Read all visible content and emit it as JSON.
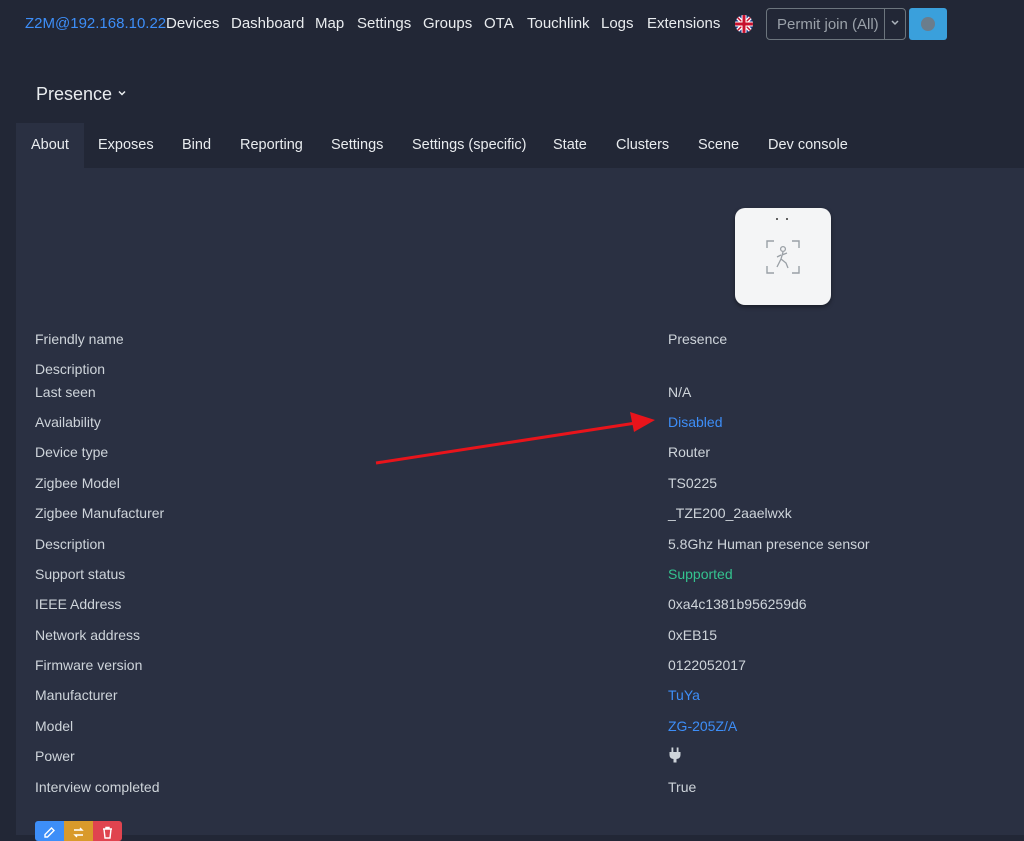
{
  "nav": {
    "brand": "Z2M@192.168.10.22",
    "items": [
      "Devices",
      "Dashboard",
      "Map",
      "Settings",
      "Groups",
      "OTA",
      "Touchlink",
      "Logs",
      "Extensions"
    ],
    "permit_join_label": "Permit join (All)"
  },
  "page": {
    "title": "Presence"
  },
  "tabs": [
    "About",
    "Exposes",
    "Bind",
    "Reporting",
    "Settings",
    "Settings (specific)",
    "State",
    "Clusters",
    "Scene",
    "Dev console"
  ],
  "about": {
    "rows": [
      {
        "label": "Friendly name",
        "value": "Presence"
      },
      {
        "label": "Description",
        "value": ""
      },
      {
        "label": "Last seen",
        "value": "N/A"
      },
      {
        "label": "Availability",
        "value": "Disabled"
      },
      {
        "label": "Device type",
        "value": "Router"
      },
      {
        "label": "Zigbee Model",
        "value": "TS0225"
      },
      {
        "label": "Zigbee Manufacturer",
        "value": "_TZE200_2aaelwxk"
      },
      {
        "label": "Description",
        "value": "5.8Ghz Human presence sensor"
      },
      {
        "label": "Support status",
        "value": "Supported"
      },
      {
        "label": "IEEE Address",
        "value": "0xa4c1381b956259d6"
      },
      {
        "label": "Network address",
        "value": "0xEB15"
      },
      {
        "label": "Firmware version",
        "value": "0122052017"
      },
      {
        "label": "Manufacturer",
        "value": "TuYa"
      },
      {
        "label": "Model",
        "value": "ZG-205Z/A"
      },
      {
        "label": "Power",
        "value": ""
      },
      {
        "label": "Interview completed",
        "value": "True"
      }
    ],
    "power_icon": "plug-icon"
  },
  "colors": {
    "background": "#222736",
    "panel": "#2a3042",
    "link": "#3d8ef8",
    "success": "#34c38f",
    "annotation_arrow": "#e8141b",
    "edit_button": "#3d8ef8",
    "rename_button": "#d99a2b",
    "delete_button": "#e0444f"
  },
  "actions": {
    "edit_icon": "pencil-icon",
    "rename_icon": "swap-icon",
    "delete_icon": "trash-icon"
  }
}
